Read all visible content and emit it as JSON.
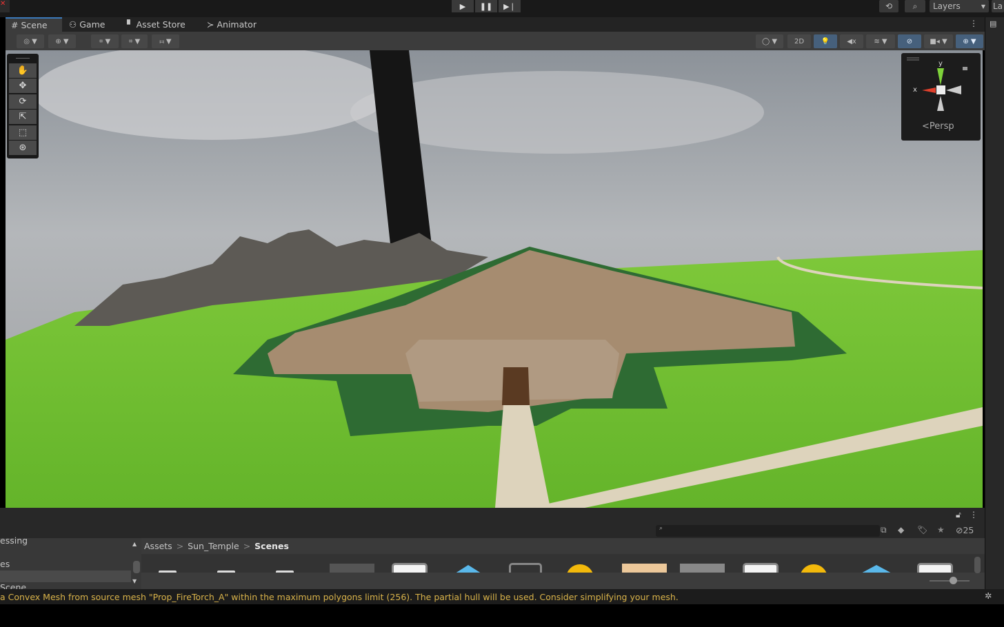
{
  "topbar": {
    "play_icon": "play-icon",
    "pause_icon": "pause-icon",
    "step_icon": "step-icon",
    "history_icon": "history-icon",
    "search_icon": "search-icon",
    "layers_label": "Layers",
    "layout_label": "La"
  },
  "tabs": [
    {
      "label": "Scene",
      "icon": "grid-icon"
    },
    {
      "label": "Game",
      "icon": "gamepad-icon"
    },
    {
      "label": "Asset Store",
      "icon": "bag-icon"
    },
    {
      "label": "Animator",
      "icon": "animator-icon"
    }
  ],
  "toolbar": {
    "toggle_2d": "2D"
  },
  "gizmo": {
    "y_label": "y",
    "x_label": "x",
    "projection": "Persp"
  },
  "project": {
    "tree_items": [
      "essing",
      "es",
      "",
      "Scene"
    ],
    "breadcrumb": [
      "Assets",
      "Sun_Temple",
      "Scenes"
    ],
    "hidden_count": "25",
    "search_placeholder": ""
  },
  "console": {
    "message": "a Convex Mesh from source mesh \"Prop_FireTorch_A\" within the maximum polygons limit (256). The partial hull will be used. Consider simplifying your mesh."
  },
  "colors": {
    "accent": "#3a79bb",
    "warning": "#d9b34a",
    "toggle_on": "#46607c"
  }
}
